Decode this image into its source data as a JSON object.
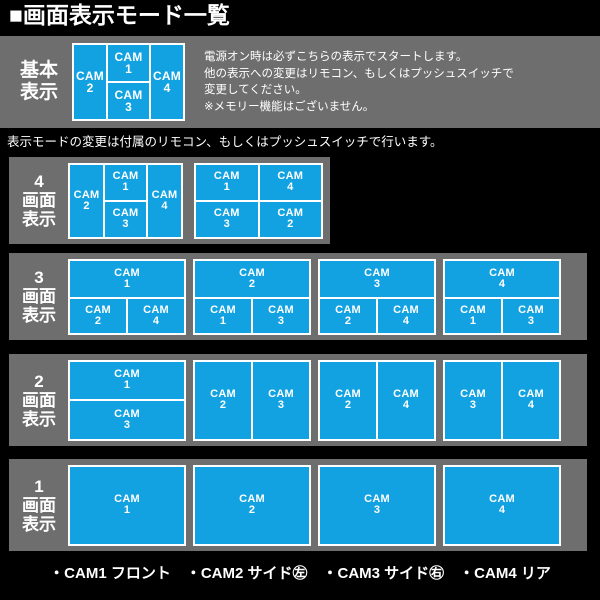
{
  "title": "■画面表示モード一覧",
  "colors": {
    "background": "#000000",
    "panel": "#6e6e6e",
    "cell": "#12a2e2",
    "cell_border": "#ffffff",
    "text": "#ffffff"
  },
  "basic": {
    "label_num": "基本",
    "label_jp": "表示",
    "note": "電源オン時は必ずこちらの表示でスタートします。\n他の表示への変更はリモコン、もしくはプッシュスイッチで\n変更してください。\n※メモリー機能はございません。",
    "diagram": {
      "left": {
        "cam": "CAM",
        "num": "2"
      },
      "middle_top": {
        "cam": "CAM",
        "num": "1"
      },
      "middle_bottom": {
        "cam": "CAM",
        "num": "3"
      },
      "right": {
        "cam": "CAM",
        "num": "4"
      }
    }
  },
  "subtext": "表示モードの変更は付属のリモコン、もしくはプッシュスイッチで行います。",
  "rows": [
    {
      "label_num": "4",
      "label_jp_1": "画面",
      "label_jp_2": "表示",
      "diagrams": [
        {
          "type": "three-col",
          "cells": {
            "left": "2",
            "mid_top": "1",
            "mid_bottom": "3",
            "right": "4"
          }
        },
        {
          "type": "quad",
          "cells": {
            "tl": "1",
            "tr": "4",
            "bl": "3",
            "br": "2"
          }
        }
      ]
    },
    {
      "label_num": "3",
      "label_jp_1": "画面",
      "label_jp_2": "表示",
      "diagrams": [
        {
          "type": "one-over-two",
          "cells": {
            "top": "1",
            "bl": "2",
            "br": "4"
          }
        },
        {
          "type": "one-over-two",
          "cells": {
            "top": "2",
            "bl": "1",
            "br": "3"
          }
        },
        {
          "type": "one-over-two",
          "cells": {
            "top": "3",
            "bl": "2",
            "br": "4"
          }
        },
        {
          "type": "one-over-two",
          "cells": {
            "top": "4",
            "bl": "1",
            "br": "3"
          }
        }
      ]
    },
    {
      "label_num": "2",
      "label_jp_1": "画面",
      "label_jp_2": "表示",
      "diagrams": [
        {
          "type": "stacked",
          "cells": {
            "top": "1",
            "bottom": "3"
          }
        },
        {
          "type": "side-by-side",
          "cells": {
            "left": "2",
            "right": "3"
          }
        },
        {
          "type": "side-by-side",
          "cells": {
            "left": "2",
            "right": "4"
          }
        },
        {
          "type": "side-by-side",
          "cells": {
            "left": "3",
            "right": "4"
          }
        }
      ]
    },
    {
      "label_num": "1",
      "label_jp_1": "画面",
      "label_jp_2": "表示",
      "diagrams": [
        {
          "type": "single",
          "cells": {
            "only": "1"
          }
        },
        {
          "type": "single",
          "cells": {
            "only": "2"
          }
        },
        {
          "type": "single",
          "cells": {
            "only": "3"
          }
        },
        {
          "type": "single",
          "cells": {
            "only": "4"
          }
        }
      ]
    }
  ],
  "cam_label": "CAM",
  "footer": "・CAM1 フロント　・CAM2 サイド㊧　・CAM3 サイド㊨　・CAM4 リア"
}
